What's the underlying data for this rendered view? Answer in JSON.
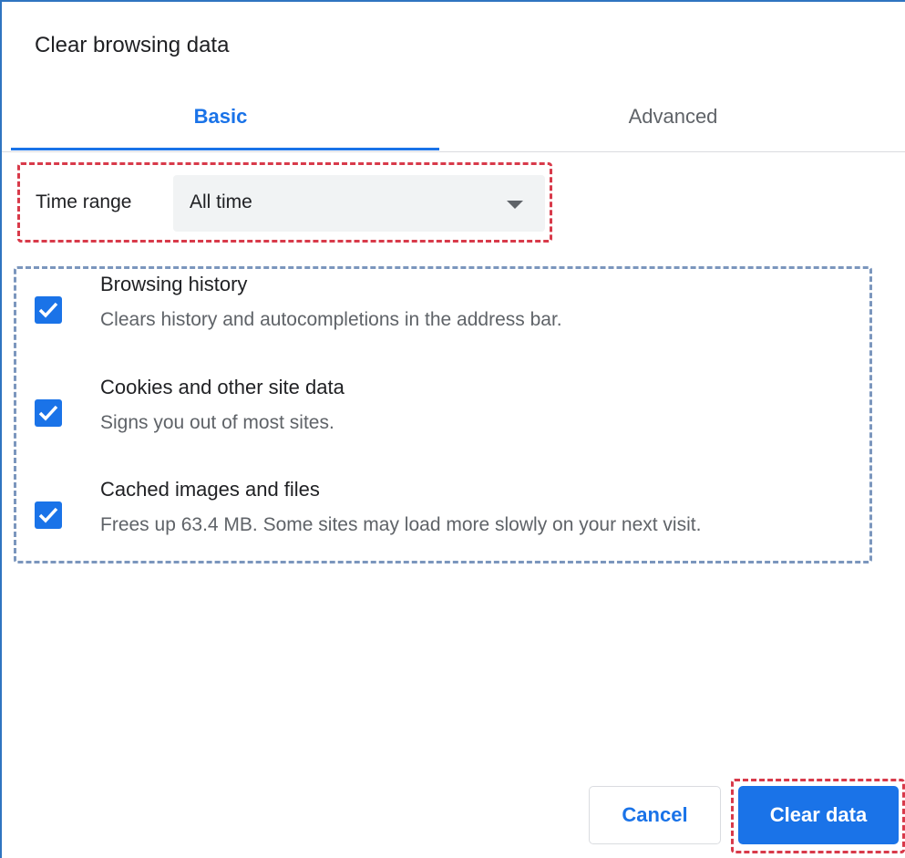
{
  "dialog": {
    "title": "Clear browsing data"
  },
  "tabs": [
    {
      "label": "Basic",
      "selected": true
    },
    {
      "label": "Advanced",
      "selected": false
    }
  ],
  "time_range": {
    "label": "Time range",
    "selected_value": "All time"
  },
  "options": [
    {
      "title": "Browsing history",
      "description": "Clears history and autocompletions in the address bar.",
      "checked": true
    },
    {
      "title": "Cookies and other site data",
      "description": "Signs you out of most sites.",
      "checked": true
    },
    {
      "title": "Cached images and files",
      "description": "Frees up 63.4 MB. Some sites may load more slowly on your next visit.",
      "checked": true
    }
  ],
  "buttons": {
    "cancel_label": "Cancel",
    "clear_label": "Clear data"
  },
  "colors": {
    "accent": "#1a73e8",
    "annotation_red": "#d83a4a",
    "annotation_blue": "#7b96bd"
  },
  "icons": {
    "dropdown": "triangle-down-icon",
    "checkbox": "checkmark-icon"
  }
}
